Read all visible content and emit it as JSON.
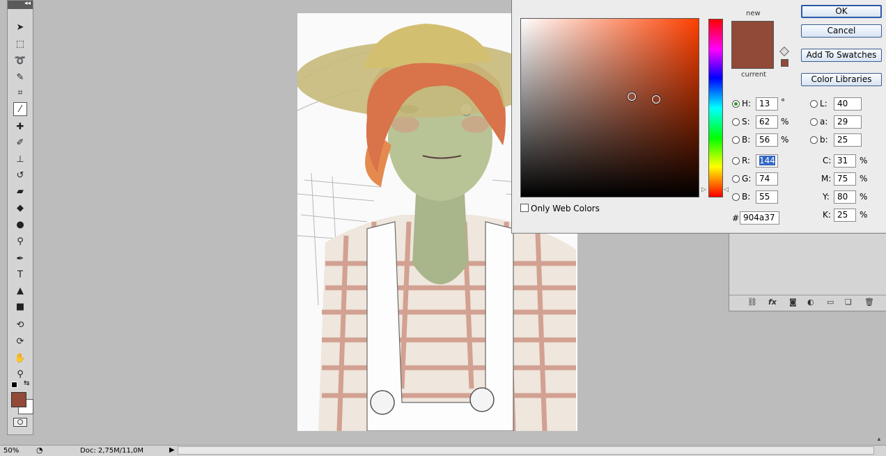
{
  "tools_panel": {
    "collapse_glyph": "◂◂",
    "tools": [
      {
        "name": "move-tool",
        "glyph": "➤"
      },
      {
        "name": "rectangular-marquee-tool",
        "glyph": "⬚"
      },
      {
        "name": "lasso-tool",
        "glyph": "➰"
      },
      {
        "name": "quick-selection-tool",
        "glyph": "✎"
      },
      {
        "name": "crop-tool",
        "glyph": "⌗"
      },
      {
        "name": "eyedropper-tool",
        "glyph": "⁄"
      },
      {
        "name": "spot-healing-brush-tool",
        "glyph": "✚"
      },
      {
        "name": "brush-tool",
        "glyph": "✐"
      },
      {
        "name": "clone-stamp-tool",
        "glyph": "⊥"
      },
      {
        "name": "history-brush-tool",
        "glyph": "↺"
      },
      {
        "name": "eraser-tool",
        "glyph": "▰"
      },
      {
        "name": "paint-bucket-tool",
        "glyph": "◆"
      },
      {
        "name": "blur-tool",
        "glyph": "●"
      },
      {
        "name": "dodge-tool",
        "glyph": "⚲"
      },
      {
        "name": "pen-tool",
        "glyph": "✒"
      },
      {
        "name": "type-tool",
        "glyph": "T"
      },
      {
        "name": "path-selection-tool",
        "glyph": "▲"
      },
      {
        "name": "rectangle-tool",
        "glyph": "■"
      },
      {
        "name": "3d-rotate-tool",
        "glyph": "⟲"
      },
      {
        "name": "3d-orbit-tool",
        "glyph": "⟳"
      },
      {
        "name": "hand-tool",
        "glyph": "✋"
      },
      {
        "name": "zoom-tool",
        "glyph": "⚲"
      }
    ],
    "foreground_color": "#904a37",
    "background_color": "#ffffff"
  },
  "color_picker": {
    "new_label": "new",
    "current_label": "current",
    "new_color": "#904a37",
    "current_color": "#904a37",
    "buttons": {
      "ok": "OK",
      "cancel": "Cancel",
      "add_to_swatches": "Add To Swatches",
      "color_libraries": "Color Libraries"
    },
    "hsb": {
      "h": {
        "label": "H:",
        "value": "13",
        "unit": "°"
      },
      "s": {
        "label": "S:",
        "value": "62",
        "unit": "%"
      },
      "b": {
        "label": "B:",
        "value": "56",
        "unit": "%"
      }
    },
    "rgb": {
      "r": {
        "label": "R:",
        "value": "144"
      },
      "g": {
        "label": "G:",
        "value": "74"
      },
      "b": {
        "label": "B:",
        "value": "55"
      }
    },
    "lab": {
      "l": {
        "label": "L:",
        "value": "40"
      },
      "a": {
        "label": "a:",
        "value": "29"
      },
      "b": {
        "label": "b:",
        "value": "25"
      }
    },
    "cmyk": {
      "c": {
        "label": "C:",
        "value": "31",
        "unit": "%"
      },
      "m": {
        "label": "M:",
        "value": "75",
        "unit": "%"
      },
      "y": {
        "label": "Y:",
        "value": "80",
        "unit": "%"
      },
      "k": {
        "label": "K:",
        "value": "25",
        "unit": "%"
      }
    },
    "hex": {
      "label": "#",
      "value": "904a37"
    },
    "only_web_colors": "Only Web Colors",
    "selected_mode": "H"
  },
  "status_bar": {
    "zoom": "50%",
    "doc_info": "Doc: 2,75M/11,0M"
  }
}
